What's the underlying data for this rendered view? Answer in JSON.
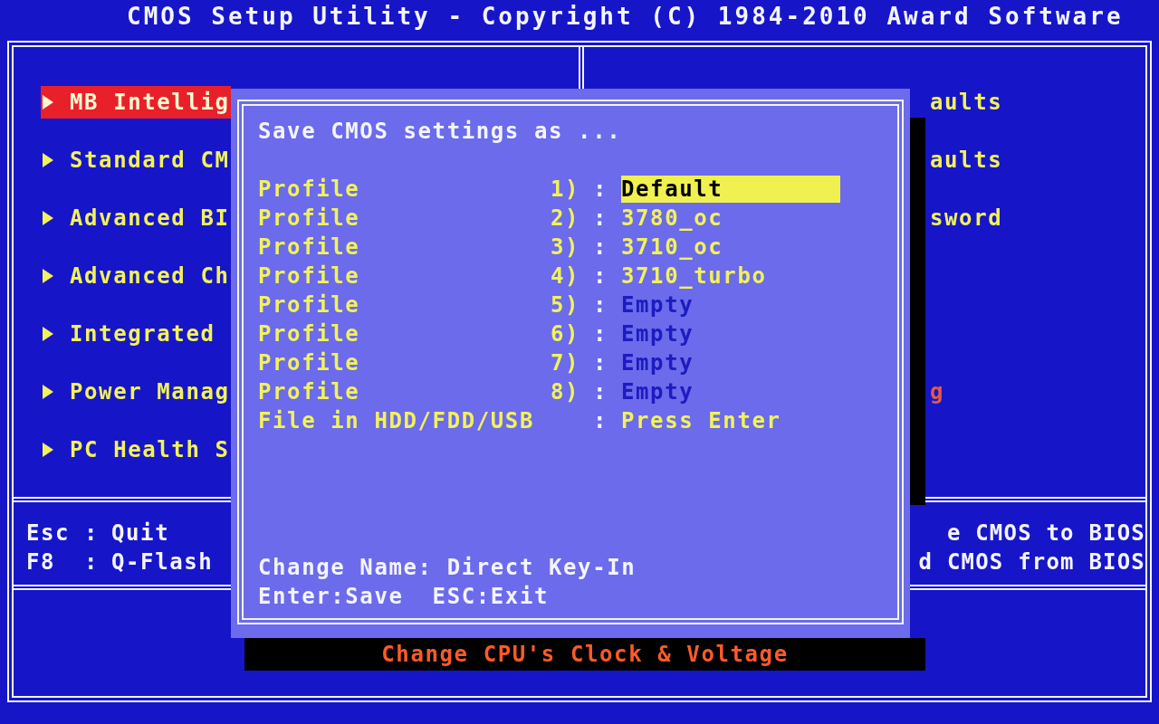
{
  "title": "CMOS Setup Utility - Copyright (C) 1984-2010 Award Software",
  "left_menu": [
    {
      "label": "MB Intellig",
      "selected": true
    },
    {
      "label": "Standard CM",
      "selected": false
    },
    {
      "label": "Advanced BI",
      "selected": false
    },
    {
      "label": "Advanced Ch",
      "selected": false
    },
    {
      "label": "Integrated",
      "selected": false
    },
    {
      "label": "Power Manag",
      "selected": false
    },
    {
      "label": "PC Health S",
      "selected": false
    }
  ],
  "right_menu": [
    {
      "label": "aults",
      "color": "#f2f25a"
    },
    {
      "label": "aults",
      "color": "#f2f25a"
    },
    {
      "label": "sword",
      "color": "#f2f25a"
    },
    {
      "label": "g",
      "color": "#e05a4a"
    }
  ],
  "help_left": [
    {
      "key": "Esc",
      "action": "Quit"
    },
    {
      "key": "F8",
      "action": "Q-Flash"
    }
  ],
  "help_right": [
    "e CMOS to BIOS",
    "d CMOS from BIOS"
  ],
  "status": "Change CPU's Clock & Voltage",
  "dialog": {
    "title": "Save CMOS settings as ...",
    "rows": [
      {
        "label": "Profile",
        "number": "1)",
        "value": "Default",
        "selected": true,
        "empty": false
      },
      {
        "label": "Profile",
        "number": "2)",
        "value": "3780_oc",
        "selected": false,
        "empty": false
      },
      {
        "label": "Profile",
        "number": "3)",
        "value": "3710_oc",
        "selected": false,
        "empty": false
      },
      {
        "label": "Profile",
        "number": "4)",
        "value": "3710_turbo",
        "selected": false,
        "empty": false
      },
      {
        "label": "Profile",
        "number": "5)",
        "value": "Empty",
        "selected": false,
        "empty": true
      },
      {
        "label": "Profile",
        "number": "6)",
        "value": "Empty",
        "selected": false,
        "empty": true
      },
      {
        "label": "Profile",
        "number": "7)",
        "value": "Empty",
        "selected": false,
        "empty": true
      },
      {
        "label": "Profile",
        "number": "8)",
        "value": "Empty",
        "selected": false,
        "empty": true
      },
      {
        "label": "File in HDD/FDD/USB",
        "value": "Press Enter",
        "selected": false,
        "empty": false
      }
    ],
    "separator": ":",
    "footer": [
      "Change Name: Direct Key-In",
      "Enter:Save  ESC:Exit"
    ]
  }
}
